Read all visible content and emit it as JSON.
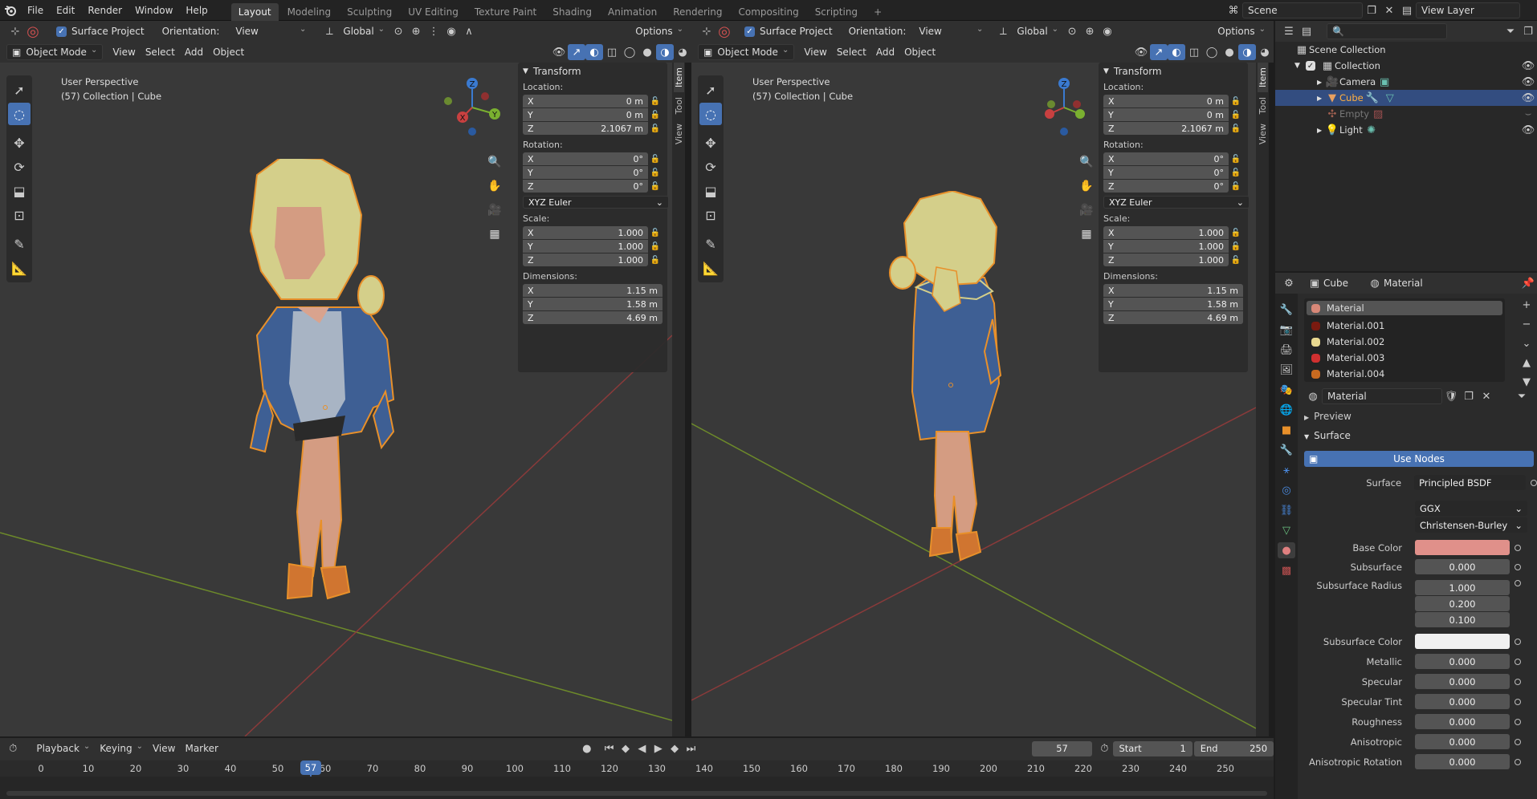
{
  "topbar": {
    "menus": [
      "File",
      "Edit",
      "Render",
      "Window",
      "Help"
    ],
    "workspaces": [
      "Layout",
      "Modeling",
      "Sculpting",
      "UV Editing",
      "Texture Paint",
      "Shading",
      "Animation",
      "Rendering",
      "Compositing",
      "Scripting"
    ],
    "active_workspace": "Layout",
    "add_tab": "+",
    "scene": "Scene",
    "view_layer": "View Layer"
  },
  "viewport_header": {
    "surface_project": "Surface Project",
    "orientation_label": "Orientation:",
    "orientation_value": "View",
    "transform_space": "Global",
    "options": "Options",
    "mode": "Object Mode",
    "menus": [
      "View",
      "Select",
      "Add",
      "Object"
    ]
  },
  "viewport": {
    "perspective": "User Perspective",
    "collection_info": "(57) Collection | Cube",
    "gizmo": {
      "x": "X",
      "y": "Y",
      "z": "Z"
    }
  },
  "sidebar_tabs": [
    "Item",
    "Tool",
    "View"
  ],
  "transform_panel": {
    "title": "Transform",
    "location_label": "Location:",
    "location": [
      {
        "axis": "X",
        "value": "0 m"
      },
      {
        "axis": "Y",
        "value": "0 m"
      },
      {
        "axis": "Z",
        "value": "2.1067 m"
      }
    ],
    "rotation_label": "Rotation:",
    "rotation": [
      {
        "axis": "X",
        "value": "0°"
      },
      {
        "axis": "Y",
        "value": "0°"
      },
      {
        "axis": "Z",
        "value": "0°"
      }
    ],
    "rotation_mode": "XYZ Euler",
    "scale_label": "Scale:",
    "scale": [
      {
        "axis": "X",
        "value": "1.000"
      },
      {
        "axis": "Y",
        "value": "1.000"
      },
      {
        "axis": "Z",
        "value": "1.000"
      }
    ],
    "dimensions_label": "Dimensions:",
    "dimensions": [
      {
        "axis": "X",
        "value": "1.15 m"
      },
      {
        "axis": "Y",
        "value": "1.58 m"
      },
      {
        "axis": "Z",
        "value": "4.69 m"
      }
    ]
  },
  "outliner": {
    "root": "Scene Collection",
    "items": [
      {
        "label": "Collection",
        "icon": "collection-icon"
      },
      {
        "label": "Camera",
        "icon": "camera-icon"
      },
      {
        "label": "Cube",
        "icon": "mesh-icon",
        "selected": true
      },
      {
        "label": "Empty",
        "icon": "empty-icon",
        "dim": true
      },
      {
        "label": "Light",
        "icon": "light-icon"
      }
    ]
  },
  "properties": {
    "object_name": "Cube",
    "material_tab": "Material",
    "material_slots": [
      "Material",
      "Material.001",
      "Material.002",
      "Material.003",
      "Material.004"
    ],
    "slot_colors": [
      "#d88878",
      "#7a1a10",
      "#e8d890",
      "#d03030",
      "#c86a20"
    ],
    "material_name": "Material",
    "preview": "Preview",
    "surface_section": "Surface",
    "use_nodes": "Use Nodes",
    "surface_label": "Surface",
    "surface_value": "Principled BSDF",
    "distribution": "GGX",
    "subsurface_method": "Christensen-Burley",
    "params": [
      {
        "label": "Base Color",
        "type": "color",
        "color": "#e0908a"
      },
      {
        "label": "Subsurface",
        "value": "0.000"
      },
      {
        "label": "Subsurface Radius",
        "values": [
          "1.000",
          "0.200",
          "0.100"
        ]
      },
      {
        "label": "Subsurface Color",
        "type": "color",
        "color": "#f0f0f0"
      },
      {
        "label": "Metallic",
        "value": "0.000"
      },
      {
        "label": "Specular",
        "value": "0.000"
      },
      {
        "label": "Specular Tint",
        "value": "0.000"
      },
      {
        "label": "Roughness",
        "value": "0.000"
      },
      {
        "label": "Anisotropic",
        "value": "0.000"
      },
      {
        "label": "Anisotropic Rotation",
        "value": "0.000"
      }
    ]
  },
  "timeline": {
    "menus": [
      "Playback",
      "Keying",
      "View",
      "Marker"
    ],
    "current_frame": "57",
    "start_label": "Start",
    "start": "1",
    "end_label": "End",
    "end": "250",
    "ticks": [
      "0",
      "10",
      "20",
      "30",
      "40",
      "50",
      "60",
      "70",
      "80",
      "90",
      "100",
      "110",
      "120",
      "130",
      "140",
      "150",
      "160",
      "170",
      "180",
      "190",
      "200",
      "210",
      "220",
      "230",
      "240",
      "250"
    ]
  }
}
